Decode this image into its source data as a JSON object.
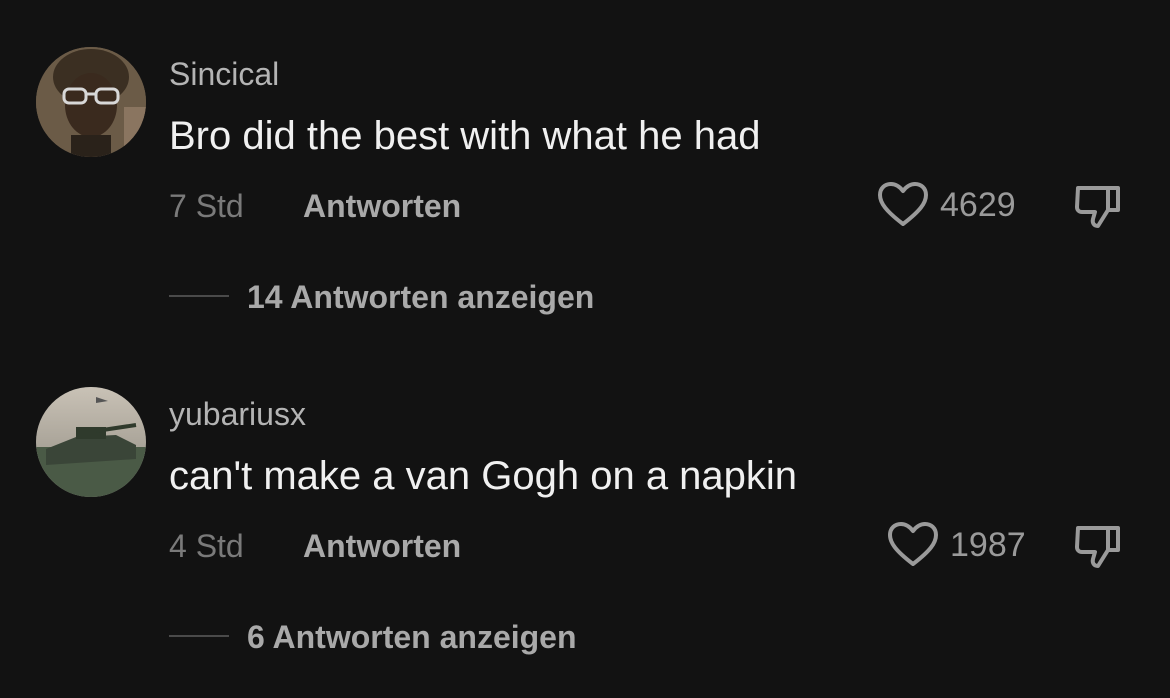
{
  "comments": [
    {
      "username": "Sincical",
      "text": "Bro did the best with what he had",
      "time": "7 Std",
      "reply_label": "Antworten",
      "likes": "4629",
      "view_replies": "14 Antworten anzeigen"
    },
    {
      "username": "yubariusx",
      "text": "can't make a van Gogh on a napkin",
      "time": "4 Std",
      "reply_label": "Antworten",
      "likes": "1987",
      "view_replies": "6 Antworten anzeigen"
    }
  ],
  "colors": {
    "background": "#121212",
    "username": "#b4b4b4",
    "text": "#f0f0f0",
    "secondary": "#7a7a7a",
    "action": "#a9a9a9"
  },
  "icons": {
    "like": "heart-outline-icon",
    "dislike": "thumbs-down-icon"
  }
}
